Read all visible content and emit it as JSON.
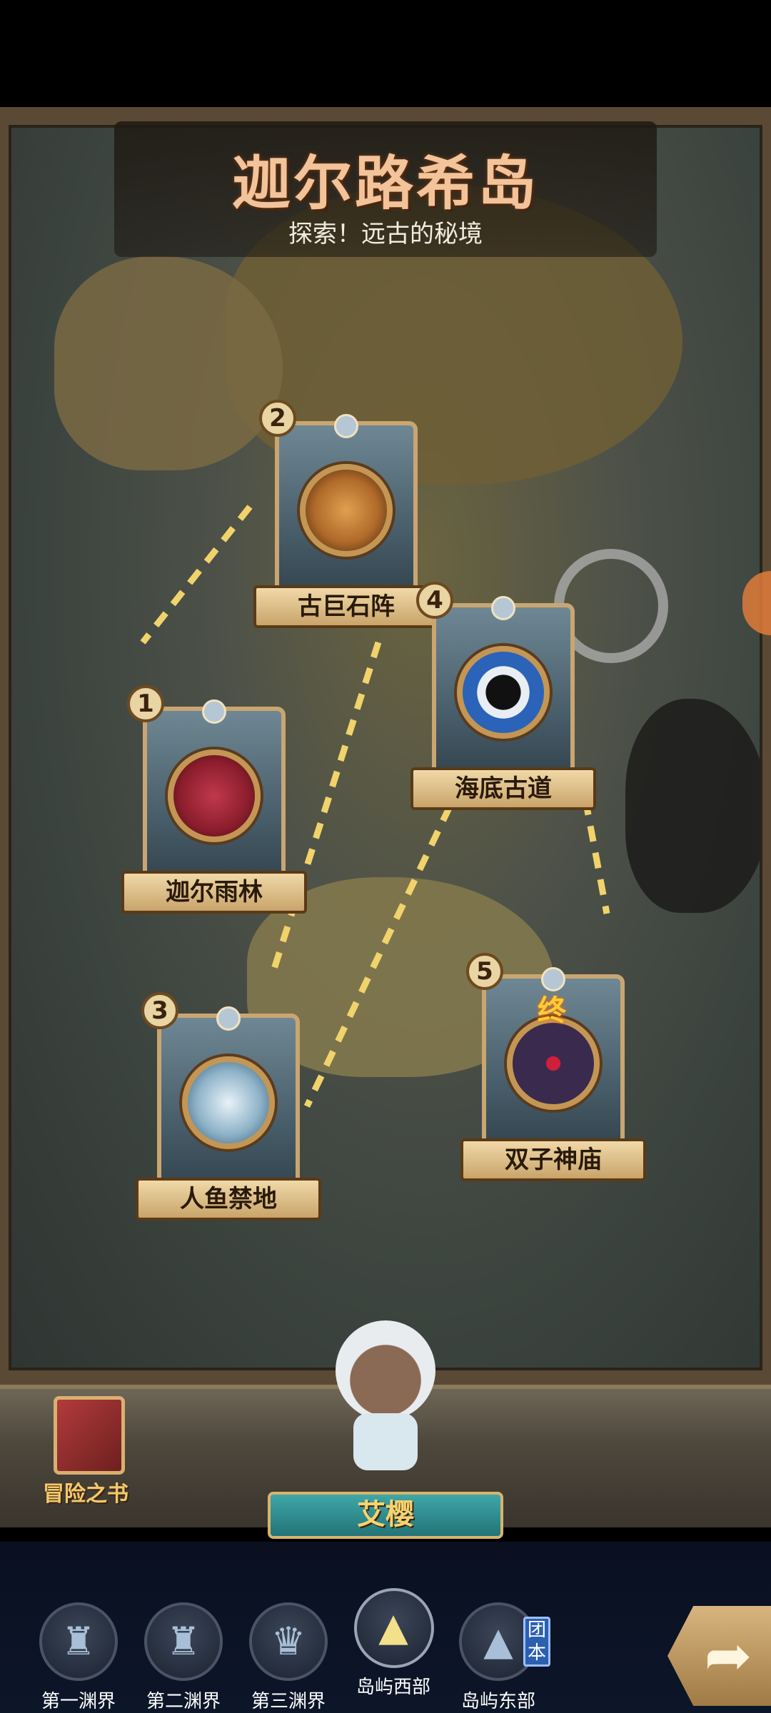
{
  "map": {
    "title": "迦尔路希岛",
    "subtitle": "探索！远古的秘境"
  },
  "stages": [
    {
      "number": "1",
      "name": "迦尔雨林",
      "portrait_color": "#8b1d2c",
      "final": false
    },
    {
      "number": "2",
      "name": "古巨石阵",
      "portrait_color": "#b06a2a",
      "final": false
    },
    {
      "number": "3",
      "name": "人鱼禁地",
      "portrait_color": "#8fb3c9",
      "final": false
    },
    {
      "number": "4",
      "name": "海底古道",
      "portrait_color": "#2a63b8",
      "final": false
    },
    {
      "number": "5",
      "name": "双子神庙",
      "portrait_color": "#3a2a4e",
      "final": true,
      "final_mark": "终"
    }
  ],
  "book": {
    "label": "冒险之书"
  },
  "character": {
    "name": "艾樱"
  },
  "nav": {
    "tabs": [
      {
        "label": "第一渊界",
        "icon": "abyss-helmet-icon",
        "active": false
      },
      {
        "label": "第二渊界",
        "icon": "abyss-helmet-icon",
        "active": false
      },
      {
        "label": "第三渊界",
        "icon": "abyss-crown-icon",
        "active": false
      },
      {
        "label": "岛屿西部",
        "icon": "island-west-icon",
        "active": true
      },
      {
        "label": "岛屿东部",
        "icon": "island-east-icon",
        "active": false,
        "badge": "团本"
      }
    ]
  },
  "colors": {
    "title": "#f3c39a",
    "label_bg": "#e5c68f",
    "nav_bg": "#0c1629",
    "path_dash": "#f1d36b"
  }
}
